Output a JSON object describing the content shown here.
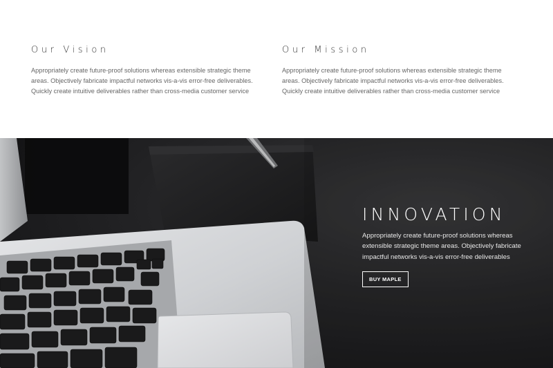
{
  "vision": {
    "title": "Our Vision",
    "body": "Appropriately create future-proof solutions whereas extensible strategic theme areas. Objectively fabricate impactful networks vis-a-vis error-free deliverables. Quickly create intuitive deliverables rather than cross-media customer service"
  },
  "mission": {
    "title": "Our Mission",
    "body": "Appropriately create future-proof solutions whereas extensible strategic theme areas. Objectively fabricate impactful networks vis-a-vis error-free deliverables. Quickly create intuitive deliverables rather than cross-media customer service"
  },
  "hero": {
    "title": "INNOVATION",
    "body": "Appropriately create future-proof solutions whereas extensible strategic theme areas. Objectively fabricate impactful networks vis-a-vis error-free deliverables",
    "button_label": "BUY MAPLE",
    "image_subject": "laptop-keyboard-photo"
  },
  "colors": {
    "hero_background": "#1c1c1e",
    "heading": "#333333",
    "body_text": "#666666",
    "button_border": "#ffffff"
  }
}
